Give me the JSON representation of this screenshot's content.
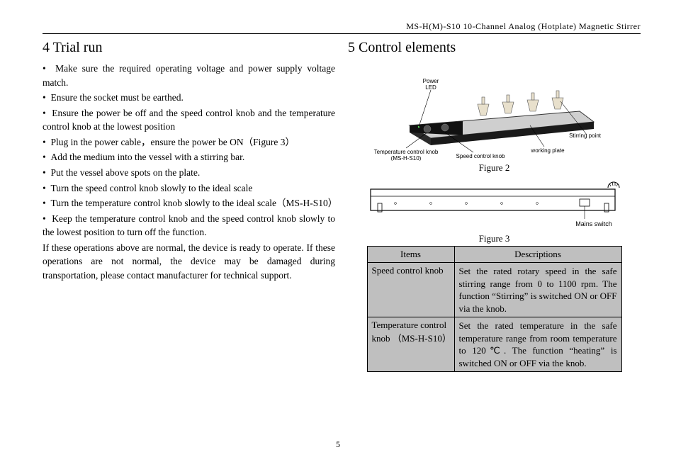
{
  "header": {
    "title": "MS-H(M)-S10 10-Channel Analog (Hotplate) Magnetic Stirrer"
  },
  "page_number": "5",
  "sections": {
    "trial_run": {
      "title": "4 Trial run",
      "bullets": [
        "Make sure the required operating voltage and power supply voltage match.",
        "Ensure the socket must be earthed.",
        "Ensure the power be off  and the speed control knob and the temperature control knob at the lowest position",
        "Plug in the power cable，ensure the power be ON（Figure 3）",
        "Add the medium into the vessel with a stirring bar.",
        "Put the vessel above spots on the plate.",
        "Turn the speed control knob slowly to the ideal scale",
        "Turn the temperature control knob slowly to the ideal scale（MS-H-S10）",
        "Keep the temperature control knob and the speed control knob slowly to the lowest position to turn off the function."
      ],
      "footer": "If these operations above are normal, the device is ready to operate. If these operations are not normal, the device may be damaged during transportation, please contact manufacturer for technical support."
    },
    "control_elements": {
      "title": "5 Control elements",
      "fig2_caption": "Figure 2",
      "fig3_caption": "Figure 3",
      "labels": {
        "power_led": "Power LED",
        "stirring_point": "Stirring point",
        "temp_knob": "Temperature control knob (MS-H-S10)",
        "speed_knob": "Speed control  knob",
        "working_plate": "working plate",
        "mains_switch": "Mains switch"
      },
      "table": {
        "head_items": "Items",
        "head_desc": "Descriptions",
        "rows": [
          {
            "item": "Speed control knob",
            "desc": "Set the rated rotary speed in the safe stirring range from 0 to 1100 rpm. The function “Stirring” is switched ON or OFF via the knob."
          },
          {
            "item": "Temperature  control knob （MS-H-S10）",
            "desc": "Set the rated temperature in the safe temperature range from room temperature to 120℃. The function “heating” is switched ON or OFF via the knob."
          }
        ]
      }
    }
  }
}
